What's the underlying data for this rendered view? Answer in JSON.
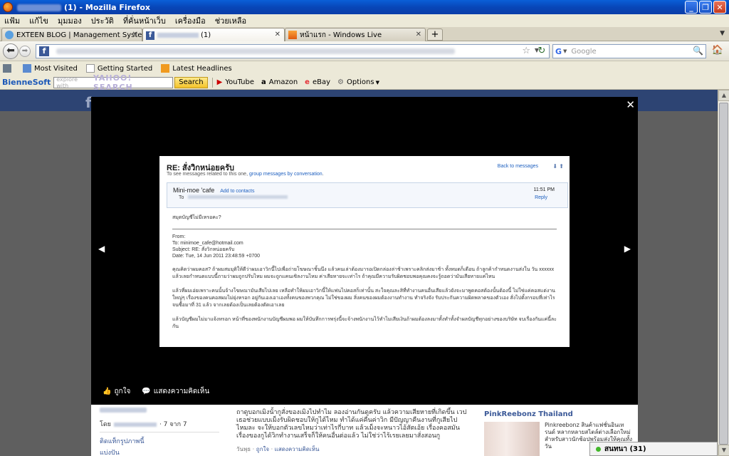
{
  "window": {
    "title": "(1) - Mozilla Firefox"
  },
  "menu": [
    "แฟ้ม",
    "แก้ไข",
    "มุมมอง",
    "ประวัติ",
    "ที่คั่นหน้าเว็บ",
    "เครื่องมือ",
    "ช่วยเหลือ"
  ],
  "tabs": [
    {
      "label": "EXTEEN BLOG | Management System",
      "active": false
    },
    {
      "label": "(1)",
      "active": true
    },
    {
      "label": "หน้าแรก - Windows Live",
      "active": false
    }
  ],
  "tab_new": "+",
  "search": {
    "placeholder": "Google",
    "engine": "G"
  },
  "bookmarks": [
    "Most Visited",
    "Getting Started",
    "Latest Headlines"
  ],
  "toolbar": {
    "brand": "BienneSoft",
    "yahoo_placeholder": "explore with",
    "yahoo_logo": "YAHOO! SEARCH",
    "search_button": "Search",
    "links": [
      "YouTube",
      "Amazon",
      "eBay",
      "Options"
    ]
  },
  "photo_viewer": {
    "actions": [
      "ถูกใจ",
      "แสดงความคิดเห็น"
    ]
  },
  "email": {
    "subject": "RE: สั่งวิกหน่อยครับ",
    "back_link": "Back to messages",
    "hint_prefix": "To see messages related to this one,",
    "hint_link": "group messages by conversation",
    "sender": "Mini-moe 'cafe",
    "add_contacts": "Add to contacts",
    "to_label": "To",
    "time": "11:51 PM",
    "reply": "Reply",
    "question": "สมุดบัญชีไม่มีเหรอคะ?",
    "from_label": "From:",
    "to_line": "To: minimoe_cafe@hotmail.com",
    "subject_line": "Subject: RE: สั่งวิกหน่อยครับ",
    "date_line": "Date: Tue, 14 Jun 2011 23:48:59 +0700",
    "para1": "คุณคิดว่าผมคอส? ถ้าผมสมมุติให้ดีว่าผมเอาวิกนี้ไปเพื่อถ่ายโฆษณาชิ้นนึง แล้วคนเล่าต้องมารอเปิดกล่องล่าช้าเพราะคลิกส่งมาช้า ทั้งหมดก็เดือน ถ้าลูกค้ากำหนดงานส่งใน วัน xxxxxx แล้วเลยกำหนดแบบนี้ถามว่าผมถูกปรับไหม ผมจะถูกแคนเซิลงานไหม ค่าเสียหายจะเท่าไร ถ้าคุณมีความรับผิดชอบพอคุณคงจะรู้ถอดว่ามันเสียหายแค่ไหน",
    "para2": "แล้วที่ผมเอ่ยเพราะคนนั้นจ้างโฆษณามันเสียไปเลย เหลือทำให้ผมเอาวิกนี้ให้แฟนไปคอสก็เท่านั้น สะใจคุณละสิที่ทำงานคนอื่นเสียแล้วยังจะมาพูดคอสต้องนั้นต้องนี้ ไม่ใช่แค่คอสแต่งานใหญ่ๆ เรื่องของคนคอสผมไม่ยุ่งหรอก อยู่กันเองเอาเองทั้งคนของพวกคุณ ไม่ใช่ของผม สิ่งคนของผมต้องงานทำงาน ทำจริงจัง รับประกันความผิดพลาดของตัวเอง สั่งไปตั้งกรอบที่เท่าไร จนซื้อมาที่ 31 แล้ว จากเลยต้องเป็นเลยต้องตัดเอาเลย",
    "para3": "แล้วบัญชีผมไม่มาแจ้งหรอก หน้าที่ของพนักงานบัญชีผมพอ ผมให้บันทึกการพรุ่งนี้จะจ้างพนักงานไว้ทำไมเสียเงินถ้าผมต้องลงมาทั้งทำทั้งจำผลบัญชีทุกอย่างของบริษัท จบเรื่องกันแค่นี้ละกัน"
  },
  "below": {
    "by_prefix": "โดย",
    "by_suffix": "· 7 จาก 7",
    "edit_album": "ติดแท็กรูปภาพนี้",
    "share": "แบ่งปัน",
    "description": "ถาดูบอกเมิงนั้ากูสั่งของเมิงไปทำไม ลองอ่านกันดูครับ แล้วความเสียหายที่เกิดขึ้น เวปเธอช่วยแบบเม็งรับผิดชอบให้กูได้ไหม ทำได้แค่คืนค่าวิก มีปัญญาคืนงานที่กูเสียไปไหมละ จะให้บอกตัวเลขไหมว่าเท่าไรกี่บาท แล้วเม็งจะหนาวไอ้สัตเอ้ย เรื่องคอสมันเรื่องของกูได้วิกทำงานเสร็จก็ให้คนอื่นต่อแล้ว ไม่ใช่ว่าไร้เรยเลยมาสั่งสอนกู",
    "meta_prefix": "วันพุธ ·",
    "meta_like": "ถูกใจ",
    "meta_comment": "แสดงความคิดเห็น",
    "ad_title": "PinkReebonz Thailand",
    "ad_text": "Pinkreebonz สินค้าแฟชั่นอินเทรนด์ หลากหลายสไตล์ต่างเลือกใหม่ สำหรับสาวนักช้อปพร้อมส่งให้คุณทั้งวัน"
  },
  "chat": {
    "label": "สนทนา (31)"
  }
}
